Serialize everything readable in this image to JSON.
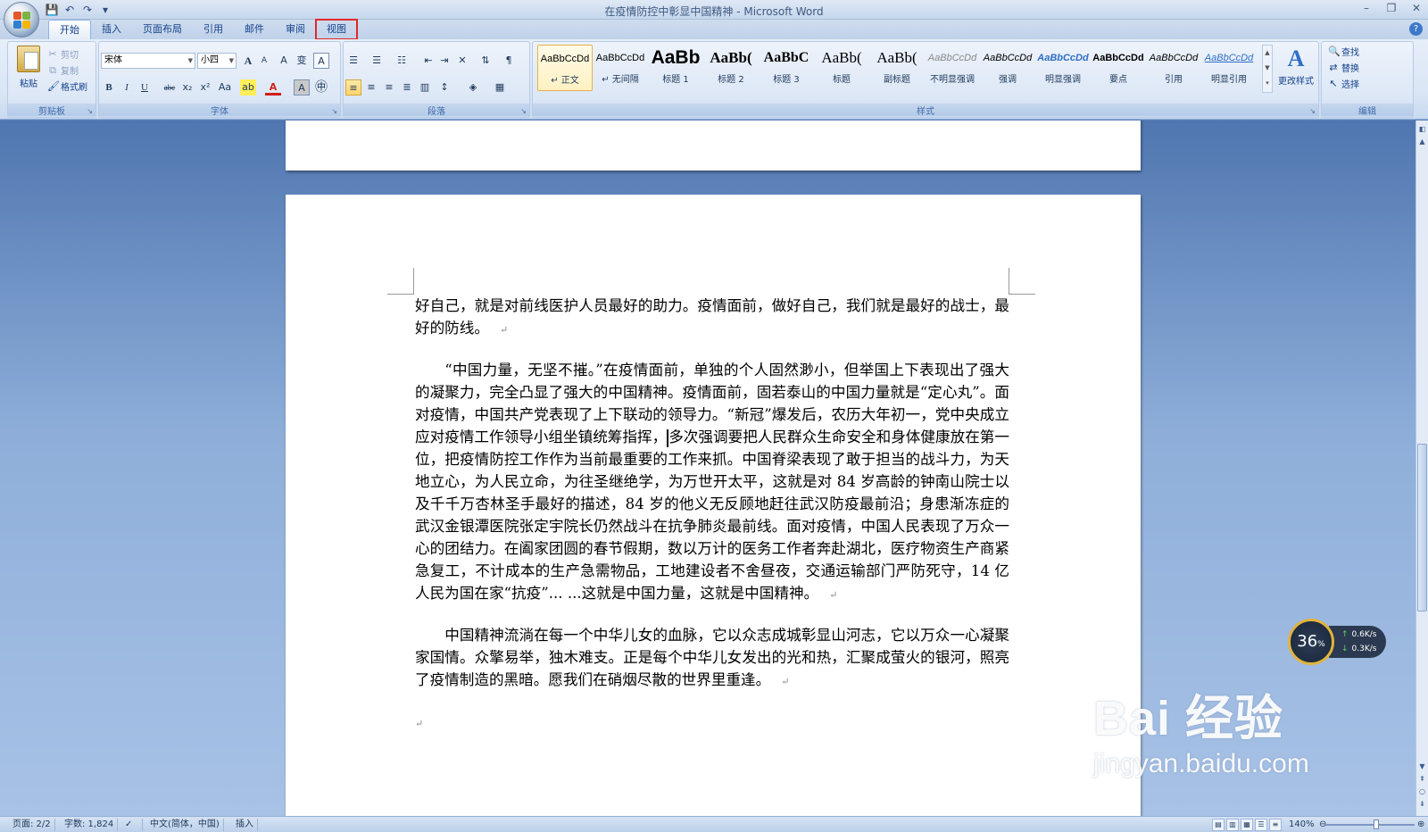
{
  "window": {
    "title": "在疫情防控中彰显中国精神 - Microsoft Word",
    "controls": [
      "–",
      "❐",
      "✕"
    ]
  },
  "qat": {
    "save_icon": "💾",
    "undo_icon": "↶",
    "redo_icon": "↷",
    "customize_icon": "▾"
  },
  "tabs": [
    {
      "label": "开始",
      "active": true
    },
    {
      "label": "插入"
    },
    {
      "label": "页面布局"
    },
    {
      "label": "引用"
    },
    {
      "label": "邮件"
    },
    {
      "label": "审阅"
    },
    {
      "label": "视图",
      "highlighted": true
    }
  ],
  "ribbon": {
    "clipboard": {
      "label": "剪贴板",
      "paste": "粘贴",
      "cut": "剪切",
      "copy": "复制",
      "format_painter": "格式刷"
    },
    "font": {
      "label": "字体",
      "font_name": "宋体",
      "font_size": "小四",
      "grow": "A",
      "shrink": "A",
      "clear": "A",
      "phonetic": "变",
      "border_char": "A",
      "bold": "B",
      "italic": "I",
      "underline": "U",
      "strike": "abc",
      "subscript": "x₂",
      "superscript": "x²",
      "change_case": "Aa",
      "highlight": "ab",
      "font_color": "A",
      "shading": "A",
      "enclose": "㊥"
    },
    "paragraph": {
      "label": "段落"
    },
    "styles": {
      "label": "样式",
      "items": [
        {
          "sample": "AaBbCcDd",
          "name": "↵ 正文",
          "active": true
        },
        {
          "sample": "AaBbCcDd",
          "name": "↵ 无间隔"
        },
        {
          "sample": "AaBb",
          "name": "标题 1"
        },
        {
          "sample": "AaBb(",
          "name": "标题 2"
        },
        {
          "sample": "AaBbC",
          "name": "标题 3"
        },
        {
          "sample": "AaBb(",
          "name": "标题"
        },
        {
          "sample": "AaBb(",
          "name": "副标题"
        },
        {
          "sample": "AaBbCcDd",
          "name": "不明显强调"
        },
        {
          "sample": "AaBbCcDd",
          "name": "强调"
        },
        {
          "sample": "AaBbCcDd",
          "name": "明显强调"
        },
        {
          "sample": "AaBbCcDd",
          "name": "要点"
        },
        {
          "sample": "AaBbCcDd",
          "name": "引用"
        },
        {
          "sample": "AaBbCcDd",
          "name": "明显引用"
        }
      ],
      "change_styles": "更改样式"
    },
    "editing": {
      "label": "编辑",
      "find": "查找",
      "replace": "替换",
      "select": "选择"
    }
  },
  "document": {
    "paragraphs": [
      {
        "text": "好自己，就是对前线医护人员最好的助力。疫情面前，做好自己，我们就是最好的战士，最好的防线。",
        "indent": false
      },
      {
        "text": "“中国力量，无坚不摧。”在疫情面前，单独的个人固然渺小，但举国上下表现出了强大的凝聚力，完全凸显了强大的中国精神。疫情面前，固若泰山的中国力量就是“定心丸”。面对疫情，中国共产党表现了上下联动的领导力。“新冠”爆发后，农历大年初一，党中央成立应对疫情工作领导小组坐镇统筹指挥，",
        "text2": "多次强调要把人民群众生命安全和身体健康放在第一位，把疫情防控工作作为当前最重要的工作来抓。中国脊梁表现了敢于担当的战斗力，为天地立心，为人民立命，为往圣继绝学，为万世开太平，这就是对 84 岁高龄的钟南山院士以及千千万杏林圣手最好的描述，84 岁的他义无反顾地赶往武汉防疫最前沿；身患渐冻症的武汉金银潭医院张定宇院长仍然战斗在抗争肺炎最前线。面对疫情，中国人民表现了万众一心的团结力。在阖家团圆的春节假期，数以万计的医务工作者奔赴湖北，医疗物资生产商紧急复工，不计成本的生产急需物品，工地建设者不舍昼夜，交通运输部门严防死守，14 亿人民为国在家“抗疫”... ...这就是中国力量，这就是中国精神。",
        "indent": true
      },
      {
        "text": "中国精神流淌在每一个中华儿女的血脉，它以众志成城彰显山河志，它以万众一心凝聚家国情。众擎易举，独木难支。正是每个中华儿女发出的光和热，汇聚成萤火的银河，照亮了疫情制造的黑暗。愿我们在硝烟尽散的世界里重逢。",
        "indent": true
      }
    ],
    "pilcrow": "↵"
  },
  "widget": {
    "percent": "36",
    "percent_unit": "%",
    "up": "0.6K/s",
    "down": "0.3K/s"
  },
  "watermark": {
    "line1": "Bai 经验",
    "line2": "jingyan.baidu.com"
  },
  "status": {
    "page": "页面: 2/2",
    "words": "字数: 1,824",
    "language": "中文(简体，中国)",
    "mode": "插入",
    "zoom": "140%"
  }
}
